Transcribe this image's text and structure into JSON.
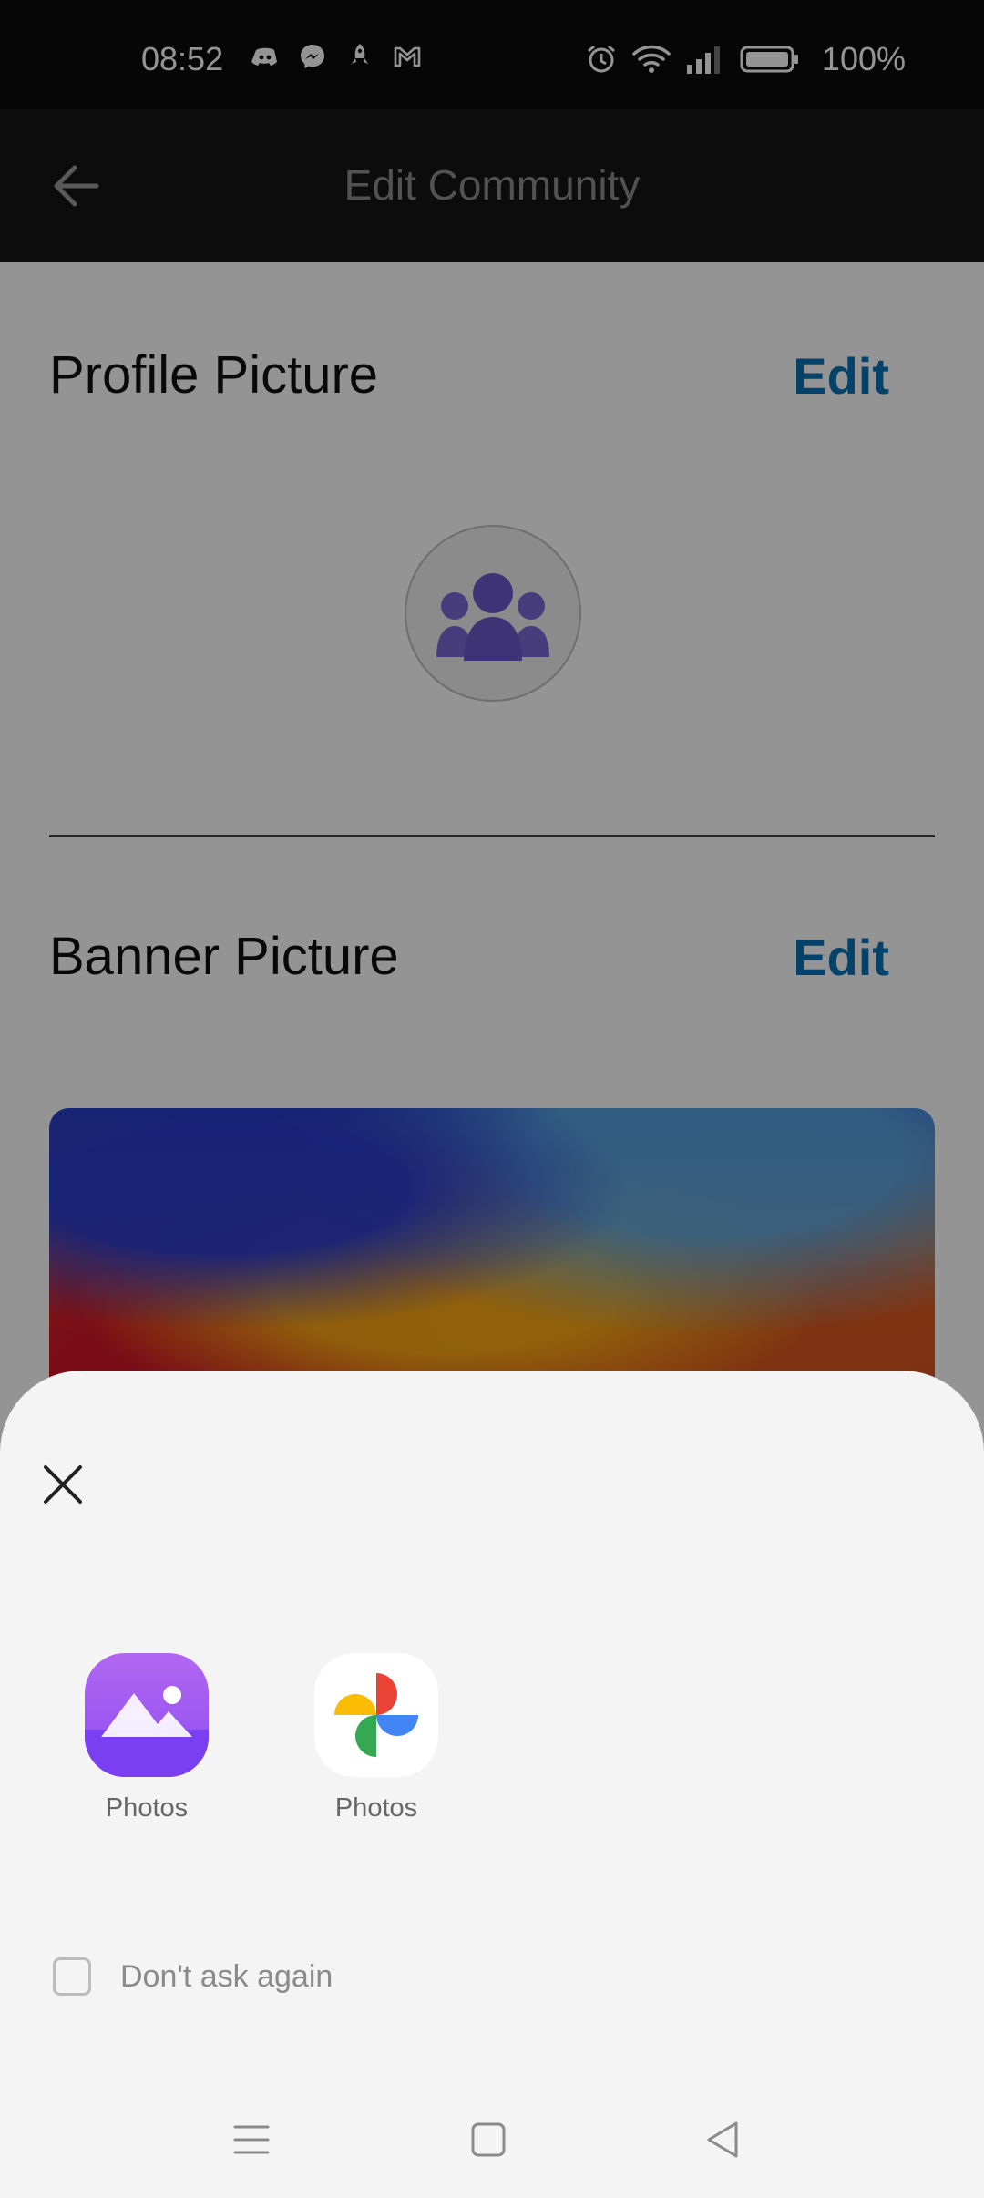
{
  "status_bar": {
    "time": "08:52",
    "battery_percent": "100%",
    "left_icons": [
      "discord-icon",
      "messenger-icon",
      "rocket-icon",
      "gmail-icon"
    ],
    "right_icons": [
      "alarm-icon",
      "wifi-icon",
      "signal-icon",
      "battery-icon"
    ]
  },
  "app_bar": {
    "title": "Edit Community",
    "back_icon": "arrow-left-icon"
  },
  "profile_section": {
    "title": "Profile Picture",
    "edit_label": "Edit",
    "avatar_icon": "group-icon"
  },
  "banner_section": {
    "title": "Banner Picture",
    "edit_label": "Edit"
  },
  "chooser_sheet": {
    "close_icon": "close-icon",
    "apps": [
      {
        "label": "Photos",
        "icon": "gallery-photos-icon"
      },
      {
        "label": "Photos",
        "icon": "google-photos-icon"
      }
    ],
    "dont_ask_label": "Don't ask again",
    "dont_ask_checked": false
  },
  "nav_bar": {
    "icons": [
      "menu-icon",
      "home-square-icon",
      "back-triangle-icon"
    ]
  },
  "colors": {
    "accent_edit": "#0a73b7",
    "avatar_purple": "#6b59c9",
    "sheet_bg": "#f4f4f4"
  }
}
